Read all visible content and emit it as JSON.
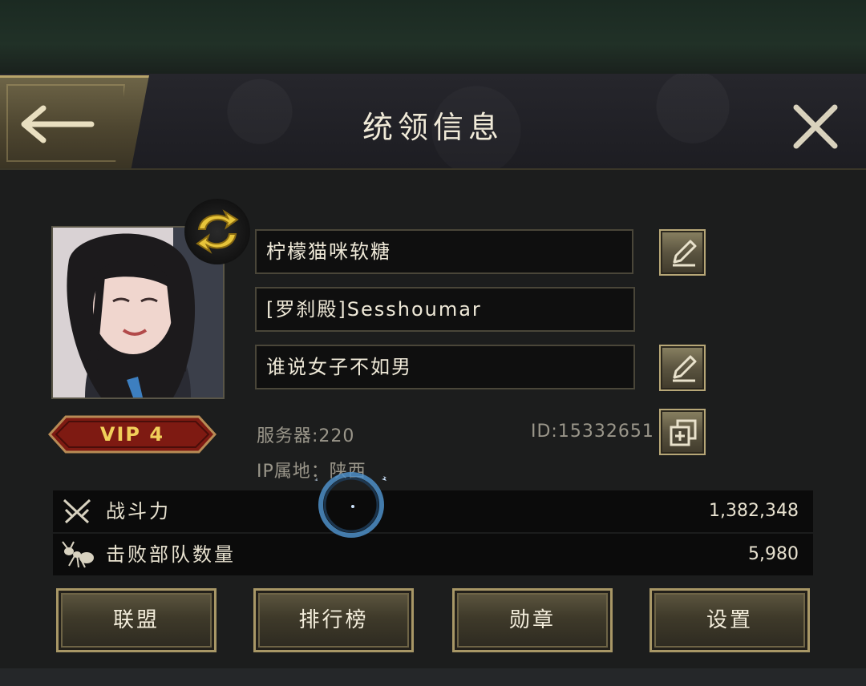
{
  "header": {
    "title": "统领信息"
  },
  "profile": {
    "name": "柠檬猫咪软糖",
    "alliance_name": "[罗刹殿]Sesshoumar",
    "signature": "谁说女子不如男",
    "vip_label": "VIP 4",
    "server_label": "服务器:220",
    "id_label": "ID:15332651",
    "ip_location_label": "IP属地：陕西"
  },
  "stats": [
    {
      "label": "战斗力",
      "value": "1,382,348",
      "icon": "crossed-swords-icon"
    },
    {
      "label": "击败部队数量",
      "value": "5,980",
      "icon": "ant-icon"
    }
  ],
  "actions": {
    "alliance": "联盟",
    "ranking": "排行榜",
    "medals": "勋章",
    "settings": "设置"
  },
  "colors": {
    "gold": "#b8a46a",
    "vip_red": "#8a1a12",
    "vip_text": "#f1cf5a",
    "panel": "#1c1d1d"
  }
}
